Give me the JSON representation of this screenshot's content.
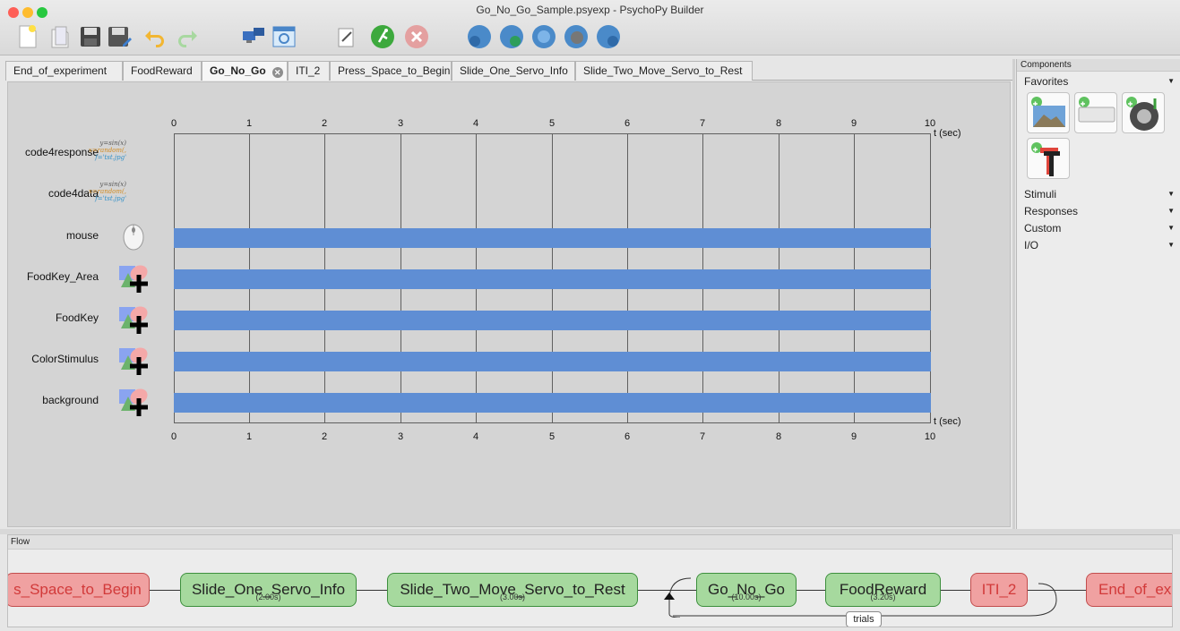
{
  "window": {
    "title": "Go_No_Go_Sample.psyexp - PsychoPy Builder"
  },
  "toolbar": {
    "buttons": [
      "new-file",
      "open-file",
      "save-file",
      "save-as",
      "undo",
      "redo",
      "monitor-center",
      "experiment-settings",
      "code-viewer",
      "run-experiment",
      "stop-experiment",
      "pavlovia-sync",
      "pavlovia-search",
      "pavlovia-project",
      "pavlovia-user",
      "pavlovia-info"
    ]
  },
  "tabs": [
    {
      "label": "End_of_experiment",
      "active": false
    },
    {
      "label": "FoodReward",
      "active": false
    },
    {
      "label": "Go_No_Go",
      "active": true
    },
    {
      "label": "ITI_2",
      "active": false
    },
    {
      "label": "Press_Space_to_Begin",
      "active": false
    },
    {
      "label": "Slide_One_Servo_Info",
      "active": false
    },
    {
      "label": "Slide_Two_Move_Servo_to_Rest",
      "active": false
    }
  ],
  "routine": {
    "ticks": [
      "0",
      "1",
      "2",
      "3",
      "4",
      "5",
      "6",
      "7",
      "8",
      "9",
      "10"
    ],
    "unit_label": "t (sec)",
    "code_icon_text": {
      "line1": "y=sin(x)",
      "line2": "x=random(,",
      "line3": "f='tst.jpg'"
    },
    "components": [
      {
        "name": "code4response",
        "icon": "code-icon",
        "start": null,
        "stop": null
      },
      {
        "name": "code4data",
        "icon": "code-icon",
        "start": null,
        "stop": null
      },
      {
        "name": "mouse",
        "icon": "mouse-icon",
        "start": 0,
        "stop": 10
      },
      {
        "name": "FoodKey_Area",
        "icon": "polygon-icon",
        "start": 0,
        "stop": 10
      },
      {
        "name": "FoodKey",
        "icon": "polygon-icon",
        "start": 0,
        "stop": 10
      },
      {
        "name": "ColorStimulus",
        "icon": "polygon-icon",
        "start": 0,
        "stop": 10
      },
      {
        "name": "background",
        "icon": "polygon-icon",
        "start": 0,
        "stop": 10
      }
    ]
  },
  "components_panel": {
    "header": "Components",
    "categories": [
      "Favorites",
      "Stimuli",
      "Responses",
      "Custom",
      "I/O"
    ],
    "favorites": [
      "image-icon",
      "keyboard-icon",
      "sound-icon",
      "text-icon"
    ]
  },
  "flow": {
    "header": "Flow",
    "routines": [
      {
        "label": "s_Space_to_Begin",
        "duration": "",
        "color": "red"
      },
      {
        "label": "Slide_One_Servo_Info",
        "duration": "(2.00s)",
        "color": "green"
      },
      {
        "label": "Slide_Two_Move_Servo_to_Rest",
        "duration": "(3.00s)",
        "color": "green"
      },
      {
        "label": "Go_No_Go",
        "duration": "(10.00s)",
        "color": "green"
      },
      {
        "label": "FoodReward",
        "duration": "(3.20s)",
        "color": "green"
      },
      {
        "label": "ITI_2",
        "duration": "",
        "color": "red"
      },
      {
        "label": "End_of_exp",
        "duration": "",
        "color": "red"
      }
    ],
    "loop_label": "trials"
  },
  "colors": {
    "bar": "#5f8ed4",
    "routine_green": "#a6d99e",
    "routine_red": "#f0a1a1"
  }
}
